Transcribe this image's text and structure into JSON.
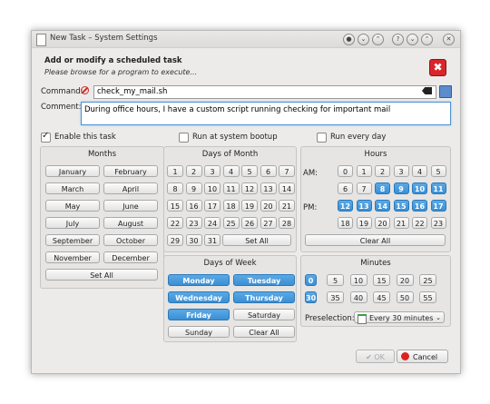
{
  "window": {
    "title": "New Task – System Settings",
    "controls": [
      "●",
      "⌄",
      "⌃",
      "?",
      "⌄",
      "⌃",
      "✕"
    ]
  },
  "header": {
    "title": "Add or modify a scheduled task",
    "subtitle": "Please browse for a program to execute...",
    "close_glyph": "✖"
  },
  "command": {
    "label": "Command:",
    "value": "check_my_mail.sh"
  },
  "comment": {
    "label": "Comment:",
    "value": "During office hours, I have a custom script running checking for important mail"
  },
  "options": {
    "enable": {
      "label": "Enable this task",
      "checked": true
    },
    "bootup": {
      "label": "Run at system bootup",
      "checked": false
    },
    "everyday": {
      "label": "Run every day",
      "checked": false
    }
  },
  "months": {
    "title": "Months",
    "items": [
      "January",
      "February",
      "March",
      "April",
      "May",
      "June",
      "July",
      "August",
      "September",
      "October",
      "November",
      "December"
    ],
    "set_all": "Set All"
  },
  "days_of_month": {
    "title": "Days of Month",
    "items": [
      "1",
      "2",
      "3",
      "4",
      "5",
      "6",
      "7",
      "8",
      "9",
      "10",
      "11",
      "12",
      "13",
      "14",
      "15",
      "16",
      "17",
      "18",
      "19",
      "20",
      "21",
      "22",
      "23",
      "24",
      "25",
      "26",
      "27",
      "28",
      "29",
      "30",
      "31"
    ],
    "set_all": "Set All"
  },
  "days_of_week": {
    "title": "Days of Week",
    "items": [
      {
        "label": "Monday",
        "selected": true
      },
      {
        "label": "Tuesday",
        "selected": true
      },
      {
        "label": "Wednesday",
        "selected": true
      },
      {
        "label": "Thursday",
        "selected": true
      },
      {
        "label": "Friday",
        "selected": true
      },
      {
        "label": "Saturday",
        "selected": false
      },
      {
        "label": "Sunday",
        "selected": false
      }
    ],
    "clear_all": "Clear All"
  },
  "hours": {
    "title": "Hours",
    "am_label": "AM:",
    "pm_label": "PM:",
    "am": [
      "0",
      "1",
      "2",
      "3",
      "4",
      "5",
      "6",
      "7",
      "8",
      "9",
      "10",
      "11"
    ],
    "pm": [
      "12",
      "13",
      "14",
      "15",
      "16",
      "17",
      "18",
      "19",
      "20",
      "21",
      "22",
      "23"
    ],
    "selected": [
      "8",
      "9",
      "10",
      "11",
      "12",
      "13",
      "14",
      "15",
      "16",
      "17"
    ],
    "clear_all": "Clear All"
  },
  "minutes": {
    "title": "Minutes",
    "items": [
      "0",
      "5",
      "10",
      "15",
      "20",
      "25",
      "30",
      "35",
      "40",
      "45",
      "50",
      "55"
    ],
    "selected": [
      "0",
      "30"
    ],
    "preselection_label": "Preselection:",
    "preselection_value": "Every 30 minutes"
  },
  "footer": {
    "ok": "OK",
    "cancel": "Cancel"
  },
  "colors": {
    "selected": "#3a8fd4",
    "close": "#d9262a"
  }
}
